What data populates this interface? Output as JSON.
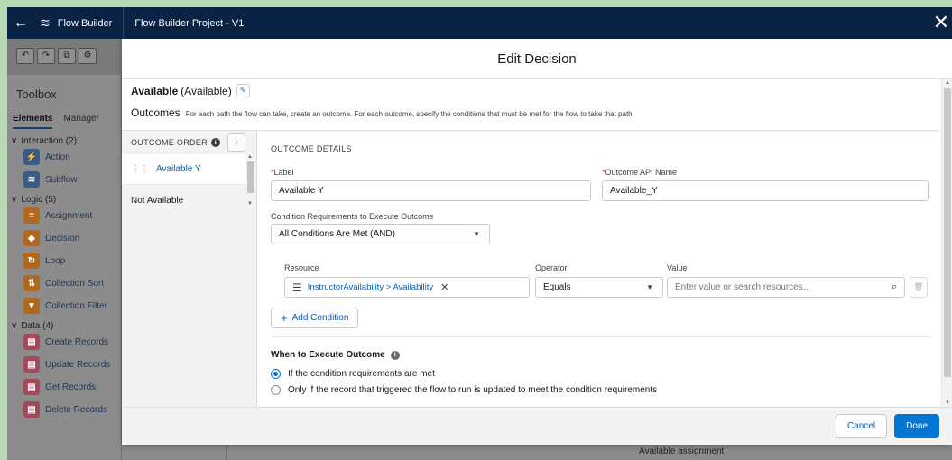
{
  "header": {
    "back_icon": "←",
    "app_name": "Flow Builder",
    "project_name": "Flow Builder Project - V1",
    "close_icon": "✕"
  },
  "toolbox": {
    "title": "Toolbox",
    "tabs": [
      "Elements",
      "Manager"
    ],
    "groups": [
      {
        "label": "Interaction (2)",
        "items": [
          {
            "label": "Action",
            "icon": "lightning-icon",
            "glyph": "⚡",
            "color": "blue"
          },
          {
            "label": "Subflow",
            "icon": "flow-icon",
            "glyph": "≋",
            "color": "blue"
          }
        ]
      },
      {
        "label": "Logic (5)",
        "items": [
          {
            "label": "Assignment",
            "icon": "assignment-icon",
            "glyph": "=",
            "color": "orange"
          },
          {
            "label": "Decision",
            "icon": "decision-icon",
            "glyph": "◆",
            "color": "orange"
          },
          {
            "label": "Loop",
            "icon": "loop-icon",
            "glyph": "↻",
            "color": "orange"
          },
          {
            "label": "Collection Sort",
            "icon": "sort-icon",
            "glyph": "⇅",
            "color": "orange"
          },
          {
            "label": "Collection Filter",
            "icon": "filter-icon",
            "glyph": "▼",
            "color": "orange"
          }
        ]
      },
      {
        "label": "Data (4)",
        "items": [
          {
            "label": "Create Records",
            "icon": "create-records-icon",
            "glyph": "▤",
            "color": "pink"
          },
          {
            "label": "Update Records",
            "icon": "update-records-icon",
            "glyph": "▤",
            "color": "pink"
          },
          {
            "label": "Get Records",
            "icon": "get-records-icon",
            "glyph": "▤",
            "color": "pink"
          },
          {
            "label": "Delete Records",
            "icon": "delete-records-icon",
            "glyph": "▤",
            "color": "pink"
          }
        ]
      }
    ]
  },
  "canvas": {
    "bottom_label": "Available assignment"
  },
  "modal": {
    "title": "Edit Decision",
    "decision_label": "Available",
    "decision_api": "(Available)",
    "outcomes_title": "Outcomes",
    "outcomes_help": "For each path the flow can take, create an outcome. For each outcome, specify the conditions that must be met for the flow to take that path.",
    "outcome_order_label": "OUTCOME ORDER",
    "outcomes": [
      {
        "label": "Available Y",
        "selected": true
      },
      {
        "label": "Not Available",
        "selected": false
      }
    ],
    "details": {
      "section_title": "OUTCOME DETAILS",
      "label_label": "Label",
      "label_value": "Available Y",
      "api_label": "Outcome API Name",
      "api_value": "Available_Y",
      "condition_req_label": "Condition Requirements to Execute Outcome",
      "condition_req_value": "All Conditions Are Met (AND)",
      "resource_label": "Resource",
      "resource_value": "InstructorAvailability > Availability",
      "operator_label": "Operator",
      "operator_value": "Equals",
      "value_label": "Value",
      "value_placeholder": "Enter value or search resources...",
      "add_condition_label": "Add Condition",
      "when_title": "When to Execute Outcome",
      "radio_options": [
        {
          "label": "If the condition requirements are met",
          "checked": true
        },
        {
          "label": "Only if the record that triggered the flow to run is updated to meet the condition requirements",
          "checked": false
        }
      ]
    },
    "footer": {
      "cancel_label": "Cancel",
      "done_label": "Done"
    }
  },
  "colors": {
    "header_bg": "#0a2244",
    "brand_button": "#0176d3",
    "link_blue": "#0b5cab",
    "outer_border": "#b9d8b4"
  }
}
